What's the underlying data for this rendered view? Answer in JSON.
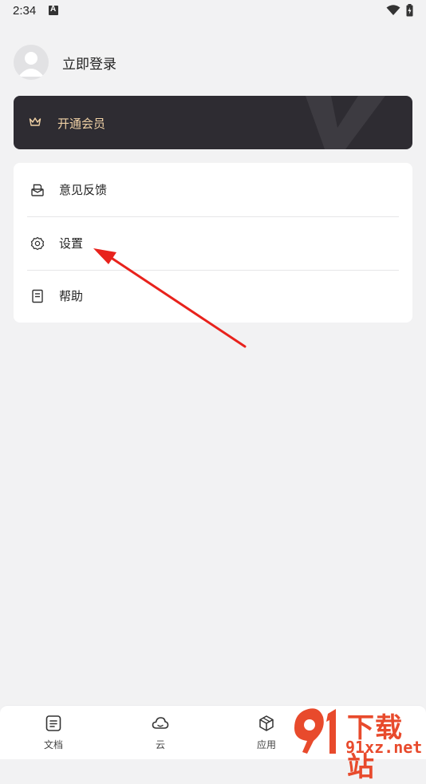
{
  "status_bar": {
    "time": "2:34"
  },
  "profile": {
    "login_label": "立即登录"
  },
  "vip": {
    "label": "开通会员",
    "accent_color": "#f0d1a5",
    "background_color": "#2e2c32"
  },
  "menu": {
    "items": [
      {
        "label": "意见反馈",
        "icon": "feedback-icon"
      },
      {
        "label": "设置",
        "icon": "gear-icon"
      },
      {
        "label": "帮助",
        "icon": "help-doc-icon"
      }
    ]
  },
  "bottom_nav": {
    "tabs": [
      {
        "label": "文档",
        "icon": "document-icon"
      },
      {
        "label": "云",
        "icon": "cloud-icon"
      },
      {
        "label": "应用",
        "icon": "cube-icon"
      }
    ]
  },
  "watermark": {
    "title": "下载站",
    "domain": "91xz.net"
  },
  "annotation_color": "#e8221c"
}
